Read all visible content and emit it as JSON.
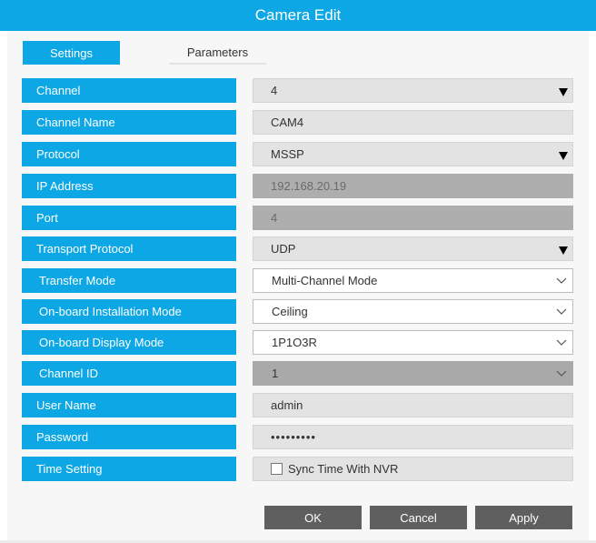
{
  "window": {
    "title": "Camera Edit"
  },
  "tabs": [
    {
      "label": "Settings"
    },
    {
      "label": "Parameters"
    }
  ],
  "form": {
    "channel": {
      "label": "Channel",
      "value": "4"
    },
    "channel_name": {
      "label": "Channel Name",
      "value": "CAM4"
    },
    "protocol": {
      "label": "Protocol",
      "value": "MSSP"
    },
    "ip_address": {
      "label": "IP Address",
      "value": "192.168.20.19"
    },
    "port": {
      "label": "Port",
      "value": "4"
    },
    "transport_protocol": {
      "label": "Transport Protocol",
      "value": "UDP"
    },
    "transfer_mode": {
      "label": "Transfer Mode",
      "value": "Multi-Channel Mode"
    },
    "installation_mode": {
      "label": "On-board Installation Mode",
      "value": "Ceiling"
    },
    "display_mode": {
      "label": "On-board Display Mode",
      "value": "1P1O3R"
    },
    "channel_id": {
      "label": "Channel ID",
      "value": "1"
    },
    "user_name": {
      "label": "User Name",
      "value": "admin"
    },
    "password": {
      "label": "Password",
      "value": "•••••••••"
    },
    "time_setting": {
      "label": "Time Setting",
      "checkbox_label": "Sync Time With NVR",
      "checked": false
    }
  },
  "buttons": {
    "ok": "OK",
    "cancel": "Cancel",
    "apply": "Apply"
  },
  "colors": {
    "accent": "#0ca7e4",
    "button": "#5f5f5f",
    "field": "#e3e3e3",
    "readonly": "#aeaeae"
  }
}
